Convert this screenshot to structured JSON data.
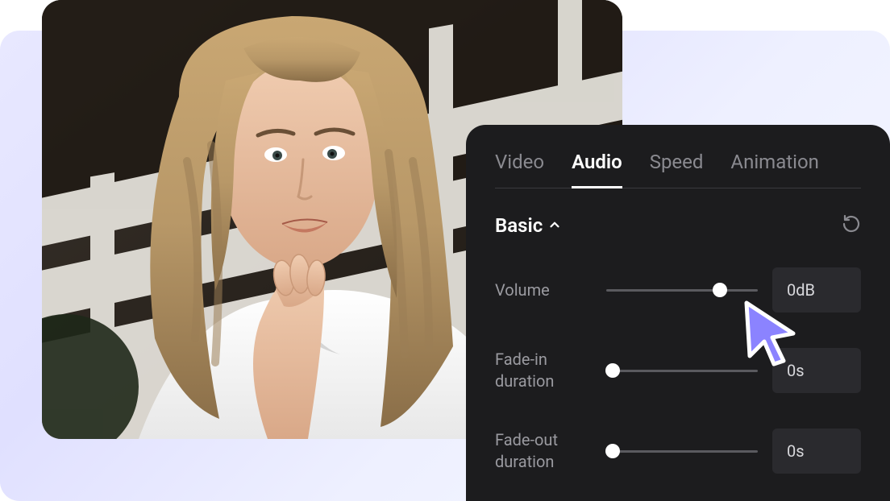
{
  "tabs": {
    "video": "Video",
    "audio": "Audio",
    "speed": "Speed",
    "animation": "Animation",
    "active": "audio"
  },
  "section": {
    "title": "Basic"
  },
  "controls": {
    "volume": {
      "label": "Volume",
      "value": "0dB",
      "thumb_pct": 75
    },
    "fadein": {
      "label": "Fade-in duration",
      "value": "0s",
      "thumb_pct": 0
    },
    "fadeout": {
      "label": "Fade-out duration",
      "value": "0s",
      "thumb_pct": 0
    }
  },
  "colors": {
    "panel_bg": "#1c1c1e",
    "accent_cursor": "#8b83ff"
  }
}
